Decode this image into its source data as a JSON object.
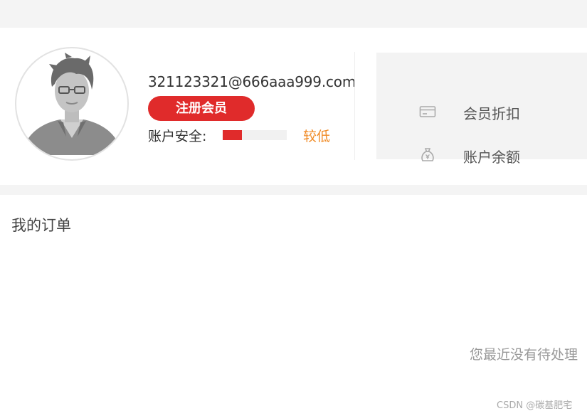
{
  "user": {
    "email": "321123321@666aaa999.com",
    "member_badge": "注册会员",
    "security_label": "账户安全:",
    "security_level": "较低",
    "security_strength_fraction": 0.3
  },
  "account": {
    "items": [
      {
        "label": "会员折扣",
        "icon": "card-icon"
      },
      {
        "label": "账户余额",
        "icon": "money-bag-icon"
      }
    ]
  },
  "orders": {
    "title": "我的订单",
    "empty_message": "您最近没有待处理"
  },
  "watermark": "CSDN @碳基肥宅",
  "colors": {
    "accent_red": "#e02b2b",
    "warning_orange": "#f08a24",
    "background_gray": "#f4f4f4"
  }
}
